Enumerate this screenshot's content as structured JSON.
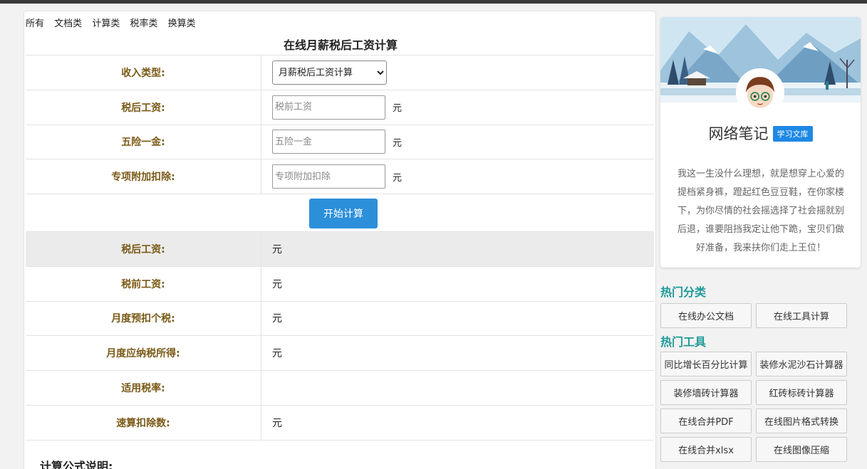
{
  "categories": [
    "所有",
    "文档类",
    "计算类",
    "税率类",
    "换算类"
  ],
  "calc": {
    "title": "在线月薪税后工资计算",
    "income_type_label": "收入类型:",
    "income_type_selected": "月薪税后工资计算",
    "after_tax_label": "税后工资:",
    "after_tax_placeholder": "税前工资",
    "insurance_label": "五险一金:",
    "insurance_placeholder": "五险一金",
    "special_label": "专项附加扣除:",
    "special_placeholder": "专项附加扣除",
    "unit": "元",
    "submit_label": "开始计算"
  },
  "results": [
    {
      "label": "税后工资:",
      "value": "元"
    },
    {
      "label": "税前工资:",
      "value": "元"
    },
    {
      "label": "月度预扣个税:",
      "value": "元"
    },
    {
      "label": "月度应纳税所得:",
      "value": "元"
    },
    {
      "label": "适用税率:",
      "value": ""
    },
    {
      "label": "速算扣除数:",
      "value": "元"
    }
  ],
  "formula_title": "计算公式说明:",
  "profile": {
    "name": "网络笔记",
    "badge": "学习文库",
    "description": "我这一生没什么理想，就是想穿上心爱的提档紧身裤，蹬起红色豆豆鞋，在你家楼下，为你尽情的社会摇选择了社会摇就别后退，谁要阻挡我定让他下跪，宝贝们做好准备，我来扶你们走上王位！"
  },
  "hot_categories": {
    "title": "热门分类",
    "items": [
      "在线办公文档",
      "在线工具计算"
    ]
  },
  "hot_tools": {
    "title": "热门工具",
    "items": [
      "同比增长百分比计算",
      "装修水泥沙石计算器",
      "装修墙砖计算器",
      "红砖标砖计算器",
      "在线合并PDF",
      "在线图片格式转换",
      "在线合并xlsx",
      "在线图像压缩"
    ]
  },
  "colors": {
    "accent": "#2c8fd9",
    "label": "#7a5a17",
    "section": "#1f9a9a",
    "result_red": "#d42a2a"
  }
}
